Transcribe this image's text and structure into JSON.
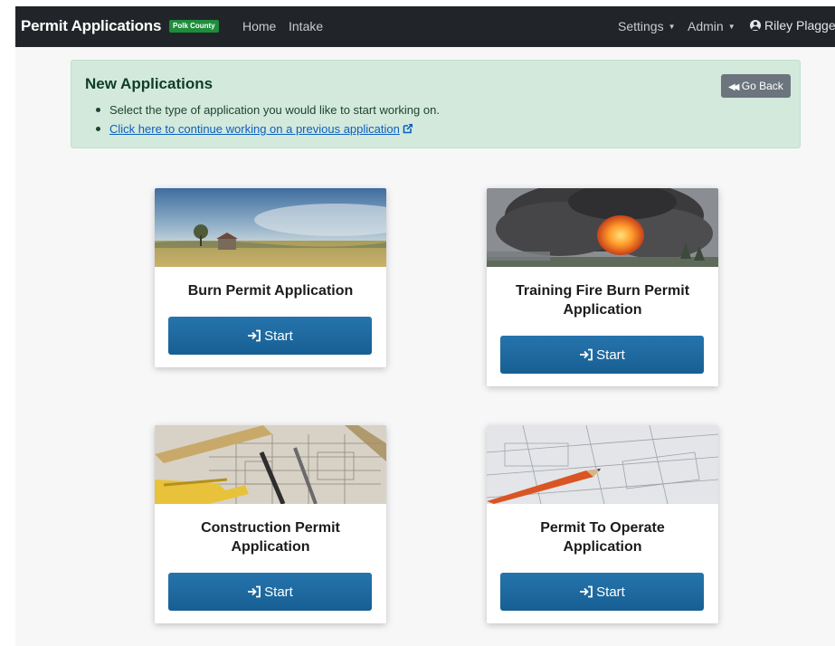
{
  "navbar": {
    "brand": "Permit Applications",
    "county_badge": "Polk County",
    "links": [
      "Home",
      "Intake"
    ],
    "settings": "Settings",
    "admin": "Admin",
    "user": "Riley Plagge"
  },
  "alert": {
    "title": "New Applications",
    "instruction": "Select the type of application you would like to start working on.",
    "continue_link": "Click here to continue working on a previous application",
    "go_back": "Go Back"
  },
  "cards": [
    {
      "title_line1": "Burn Permit Application",
      "title_line2": "",
      "button": "Start",
      "image": "rural-field-photo"
    },
    {
      "title_line1": "Training Fire Burn Permit",
      "title_line2": "Application",
      "button": "Start",
      "image": "fire-smoke-photo"
    },
    {
      "title_line1": "Construction Permit",
      "title_line2": "Application",
      "button": "Start",
      "image": "blueprint-tools-photo"
    },
    {
      "title_line1": "Permit To Operate",
      "title_line2": "Application",
      "button": "Start",
      "image": "blueprint-pencil-photo"
    }
  ],
  "colors": {
    "navbar_bg": "#212529",
    "badge": "#1e8d3c",
    "alert_bg": "#d2e9dc",
    "button": "#1e6aa1"
  }
}
